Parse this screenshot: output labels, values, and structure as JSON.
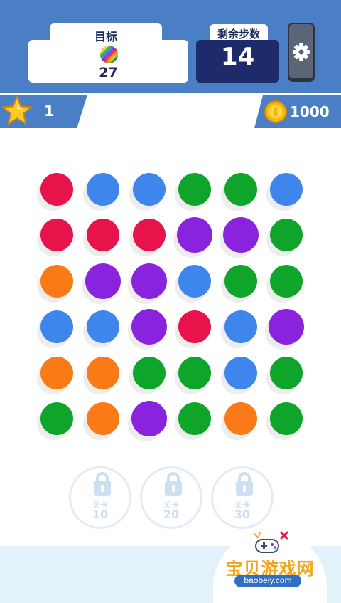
{
  "header": {
    "goal_title": "目标",
    "goal_ball_icon": "rainbow-ball-icon",
    "goal_count": "27",
    "moves_title": "剩余步数",
    "moves_value": "14",
    "settings_icon": "gear-icon"
  },
  "status": {
    "stars": "1",
    "coins": "1000"
  },
  "colors": {
    "header_blue": "#4a7fc6",
    "red": "#e8134a",
    "blue": "#3f86ec",
    "green": "#0fa52b",
    "purple": "#8a23dd",
    "orange": "#f97a17"
  },
  "board": {
    "rows": [
      [
        "red",
        "blue",
        "blue",
        "green",
        "green",
        "blue"
      ],
      [
        "red",
        "red",
        "red",
        "purple",
        "purple",
        "green"
      ],
      [
        "orange",
        "purple",
        "purple",
        "blue",
        "green",
        "green"
      ],
      [
        "blue",
        "blue",
        "purple",
        "red",
        "blue",
        "purple"
      ],
      [
        "orange",
        "orange",
        "green",
        "green",
        "blue",
        "green"
      ],
      [
        "green",
        "orange",
        "purple",
        "green",
        "orange",
        "green"
      ]
    ]
  },
  "levels": [
    {
      "label": "关卡",
      "level": "10"
    },
    {
      "label": "关卡",
      "level": "20"
    },
    {
      "label": "关卡",
      "level": "30"
    }
  ],
  "watermark": {
    "text": "宝贝游戏网",
    "url": "baobeiy.com"
  }
}
